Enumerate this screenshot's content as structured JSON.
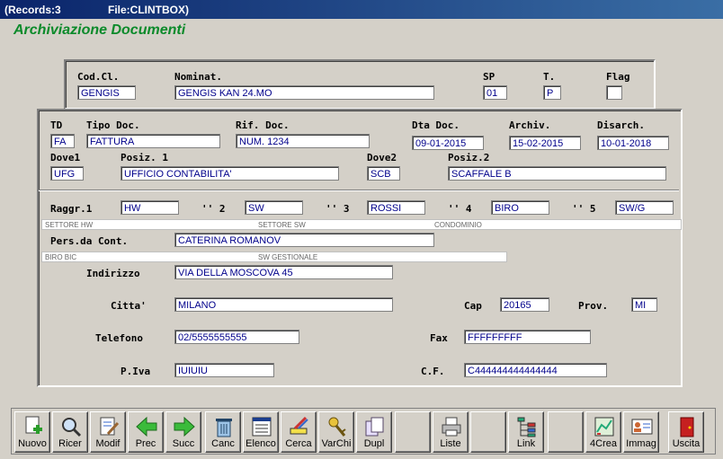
{
  "titlebar": {
    "records": "(Records:3",
    "file": "File:CLINTBOX)"
  },
  "heading": "Archiviazione Documenti",
  "client": {
    "cod_label": "Cod.Cl.",
    "cod_value": "GENGIS",
    "nominat_label": "Nominat.",
    "nominat_value": "GENGIS KAN 24.MO",
    "sp_label": "SP",
    "sp_value": "01",
    "t_label": "T.",
    "t_value": "P",
    "flag_label": "Flag",
    "flag_value": ""
  },
  "document": {
    "td_label": "TD",
    "td_value": "FA",
    "tipo_label": "Tipo Doc.",
    "tipo_value": "FATTURA",
    "rif_label": "Rif. Doc.",
    "rif_value": "NUM. 1234",
    "dta_label": "Dta Doc.",
    "dta_value": "09-01-2015",
    "archiv_label": "Archiv.",
    "archiv_value": "15-02-2015",
    "disarch_label": "Disarch.",
    "disarch_value": "10-01-2018",
    "dove1_label": "Dove1",
    "dove1_value": "UFG",
    "posiz1_label": "Posiz. 1",
    "posiz1_value": "UFFICIO CONTABILITA'",
    "dove2_label": "Dove2",
    "dove2_value": "SCB",
    "posiz2_label": "Posiz.2",
    "posiz2_value": "SCAFFALE B"
  },
  "grouping": {
    "r1_label": "Raggr.1",
    "r1_value": "HW",
    "r2_label": "'' 2",
    "r2_value": "SW",
    "r3_label": "'' 3",
    "r3_value": "ROSSI",
    "r4_label": "'' 4",
    "r4_value": "BIRO",
    "r5_label": "'' 5",
    "r5_value": "SW/G",
    "desc1": "SETTORE HW",
    "desc2": "SETTORE SW",
    "desc3": "CONDOMINIO",
    "desc4": "BIRO BIC",
    "desc5": "SW GESTIONALE"
  },
  "contact": {
    "pers_label": "Pers.da Cont.",
    "pers_value": "CATERINA ROMANOV",
    "indirizzo_label": "Indirizzo",
    "indirizzo_value": "VIA DELLA MOSCOVA 45",
    "citta_label": "Citta'",
    "citta_value": "MILANO",
    "cap_label": "Cap",
    "cap_value": "20165",
    "prov_label": "Prov.",
    "prov_value": "MI",
    "tel_label": "Telefono",
    "tel_value": "02/5555555555",
    "fax_label": "Fax",
    "fax_value": "FFFFFFFFF",
    "piva_label": "P.Iva",
    "piva_value": "IUIUIU",
    "cf_label": "C.F.",
    "cf_value": "C444444444444444"
  },
  "toolbar": {
    "nuovo": "Nuovo",
    "ricer": "Ricer",
    "modif": "Modif",
    "prec": "Prec",
    "succ": "Succ",
    "canc": "Canc",
    "elenco": "Elenco",
    "cerca": "Cerca",
    "varchi": "VarChi",
    "dupl": "Dupl",
    "liste": "Liste",
    "link": "Link",
    "crea4": "4Crea",
    "immag": "Immag",
    "uscita": "Uscita"
  },
  "icons": {
    "nuovo": "new-document-icon",
    "ricer": "magnifier-icon",
    "modif": "edit-document-icon",
    "prec": "arrow-left-icon",
    "succ": "arrow-right-icon",
    "canc": "trash-icon",
    "elenco": "list-icon",
    "cerca": "search-highlight-icon",
    "varchi": "keys-icon",
    "dupl": "duplicate-icon",
    "liste": "printer-icon",
    "link": "link-tree-icon",
    "crea4": "chart-icon",
    "immag": "id-card-icon",
    "uscita": "exit-door-icon"
  },
  "colors": {
    "heading": "#0a8a2a",
    "field_text": "#00008b",
    "titlebar": "#0a246a"
  }
}
